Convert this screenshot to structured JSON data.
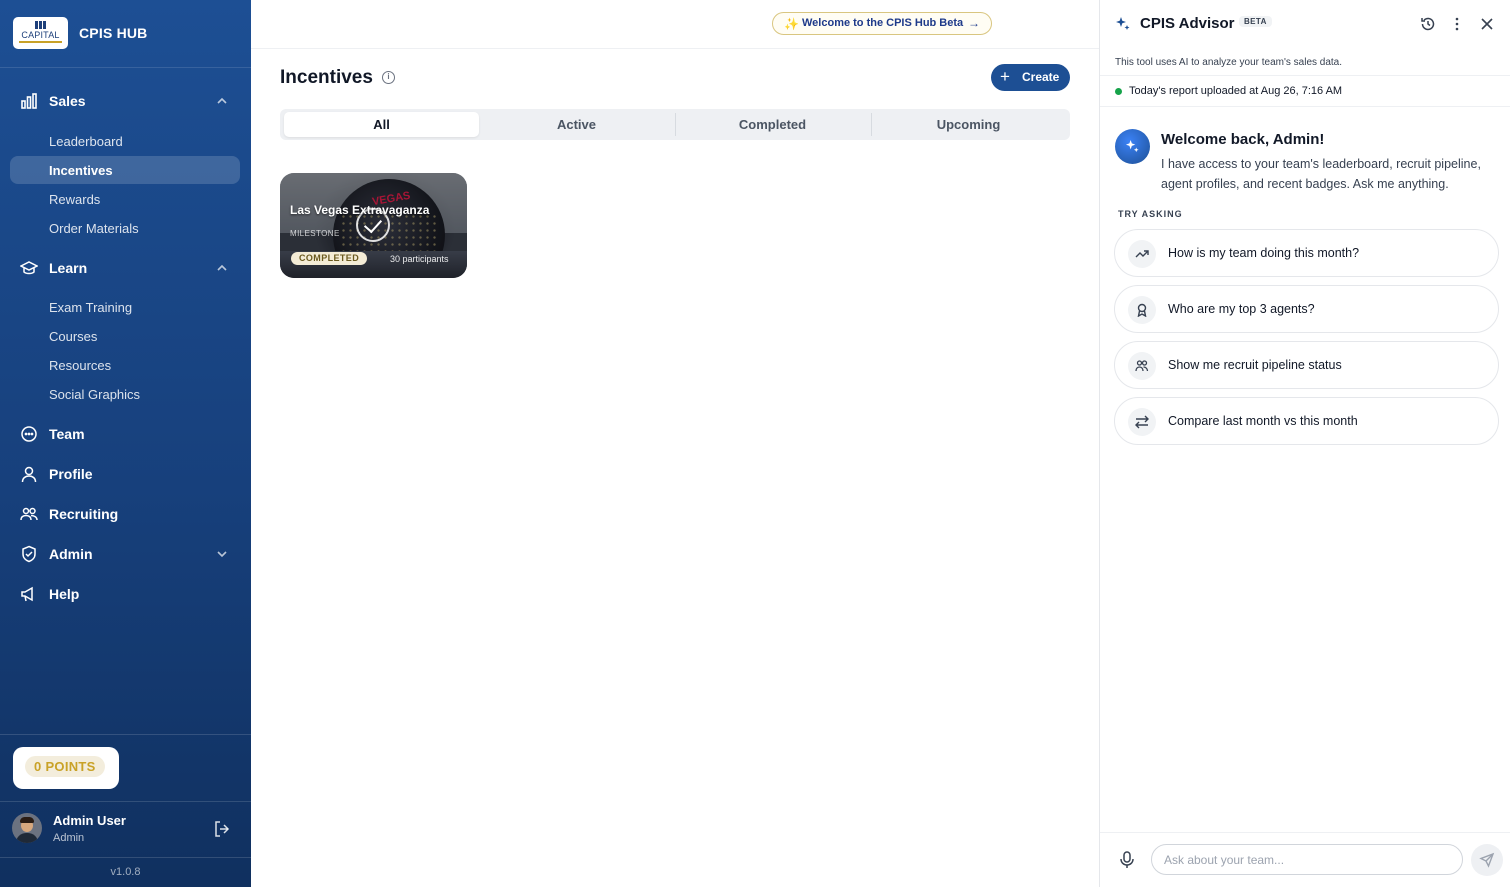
{
  "sidebar": {
    "brand_name": "CPIS HUB",
    "logo_text": "CAPITAL",
    "groups": {
      "sales": {
        "label": "Sales",
        "items": [
          "Leaderboard",
          "Incentives",
          "Rewards",
          "Order Materials"
        ],
        "active_item": "Incentives"
      },
      "learn": {
        "label": "Learn",
        "items": [
          "Exam Training",
          "Courses",
          "Resources",
          "Social Graphics"
        ]
      },
      "team": {
        "label": "Team"
      },
      "profile": {
        "label": "Profile"
      },
      "recruiting": {
        "label": "Recruiting"
      },
      "admin": {
        "label": "Admin"
      },
      "help": {
        "label": "Help"
      }
    },
    "points": "0 POINTS",
    "user": {
      "name": "Admin User",
      "role": "Admin"
    },
    "version": "v1.0.8"
  },
  "topbar": {
    "announcement": "Welcome to the CPIS Hub Beta"
  },
  "main": {
    "title": "Incentives",
    "create_label": "Create",
    "tabs": [
      "All",
      "Active",
      "Completed",
      "Upcoming"
    ],
    "active_tab": "All",
    "cards": [
      {
        "title": "Las Vegas Extravaganza",
        "type": "MILESTONE",
        "status": "COMPLETED",
        "participants": "30 participants",
        "image_text": "VEGAS"
      }
    ]
  },
  "advisor": {
    "title": "CPIS Advisor",
    "badge": "BETA",
    "disclaimer": "This tool uses AI to analyze your team's sales data.",
    "status": "Today's report uploaded at Aug 26, 7:16 AM",
    "welcome_title": "Welcome back, Admin!",
    "welcome_text": "I have access to your team's leaderboard, recruit pipeline, agent profiles, and recent badges. Ask me anything.",
    "try_label": "TRY ASKING",
    "suggestions": [
      {
        "text": "How is my team doing this month?",
        "icon": "trending-up-icon"
      },
      {
        "text": "Who are my top 3 agents?",
        "icon": "award-icon"
      },
      {
        "text": "Show me recruit pipeline status",
        "icon": "users-icon"
      },
      {
        "text": "Compare last month vs this month",
        "icon": "compare-arrows-icon"
      }
    ],
    "input_placeholder": "Ask about your team..."
  },
  "colors": {
    "sidebar": "#1d4f94",
    "accent": "#1d4f94",
    "gold": "#c9a227",
    "status_green": "#16a34a"
  }
}
